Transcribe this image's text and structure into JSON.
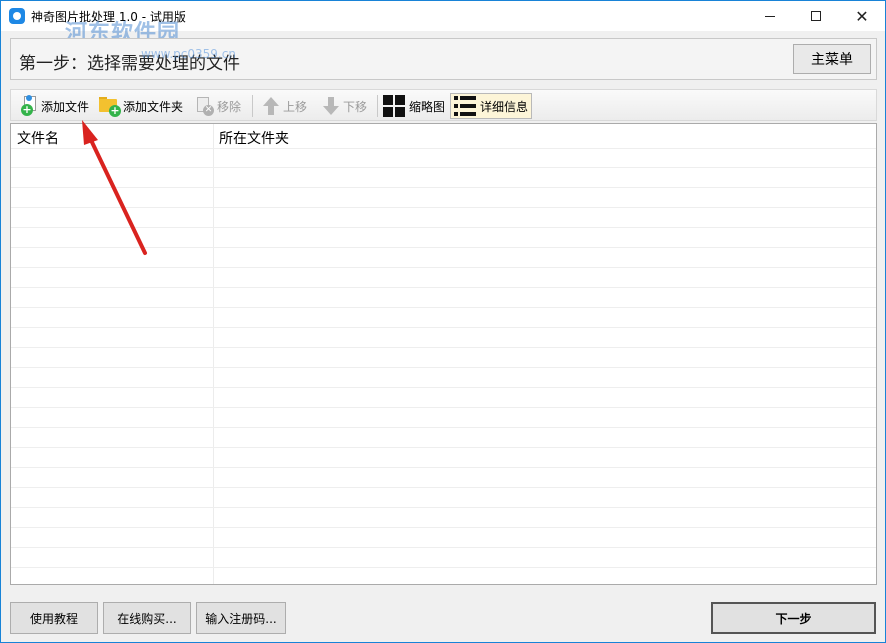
{
  "window": {
    "title": "神奇图片批处理 1.0 - 试用版",
    "watermark": "河东软件园",
    "watermark_sub": "www.pc0359.cn",
    "controls": {
      "minimize": "minimize",
      "maximize": "maximize",
      "close": "close"
    }
  },
  "header": {
    "step_text": "第一步：选择需要处理的文件",
    "main_menu_label": "主菜单"
  },
  "toolbar": {
    "add_file": "添加文件",
    "add_folder": "添加文件夹",
    "remove": "移除",
    "move_up": "上移",
    "move_down": "下移",
    "thumbnail": "缩略图",
    "details": "详细信息"
  },
  "list": {
    "columns": [
      "文件名",
      "所在文件夹"
    ],
    "rows": []
  },
  "footer": {
    "tutorial": "使用教程",
    "buy_online": "在线购买...",
    "enter_code": "输入注册码...",
    "next": "下一步"
  },
  "colors": {
    "annotation_arrow": "#d9231f",
    "window_border": "#1883d7",
    "active_view_bg": "#fdf5d8"
  },
  "icons": {
    "add_file": "add-file-icon",
    "add_folder": "add-folder-icon",
    "remove": "remove-icon",
    "move_up": "arrow-up-icon",
    "move_down": "arrow-down-icon",
    "thumbnail": "grid-icon",
    "details": "list-icon"
  }
}
